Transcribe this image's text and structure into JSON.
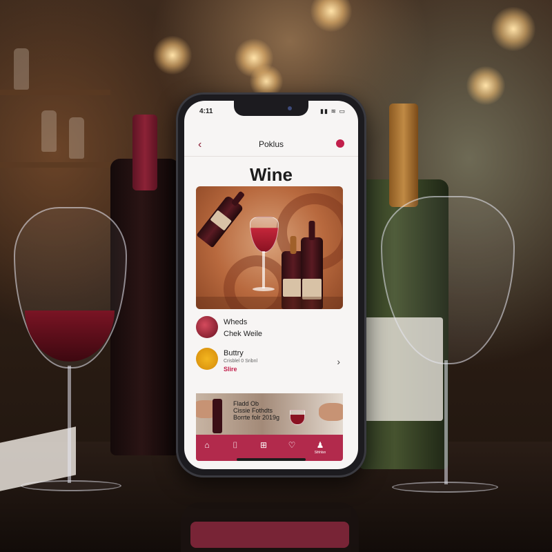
{
  "status_bar": {
    "time": "4:11",
    "icons": "▮▮ ≋ ▭"
  },
  "nav": {
    "back_icon": "‹",
    "title": "Poklus"
  },
  "page": {
    "title": "Wine"
  },
  "list": [
    {
      "title": "Wheds",
      "subtitle": "Chek Weile"
    },
    {
      "title": "Buttry",
      "subtitle": "Crisblel 0 Sribnl",
      "tag": "Slire",
      "chevron": "›"
    }
  ],
  "promo": {
    "text": "Fladd Ob\nCissie Fothdts\nBorrte folr 2019g"
  },
  "tabbar": {
    "tabs": [
      {
        "icon": "home-icon",
        "glyph": "⌂"
      },
      {
        "icon": "bookmark-icon",
        "glyph": "⌷"
      },
      {
        "icon": "gift-icon",
        "glyph": "⊞"
      },
      {
        "icon": "heart-icon",
        "glyph": "♡"
      },
      {
        "icon": "profile-icon",
        "glyph": "♟",
        "label": "Sthhlsn"
      }
    ]
  },
  "colors": {
    "accent": "#b22a4c",
    "tag": "#c21f4b",
    "screen_bg": "#f7f5f4"
  }
}
